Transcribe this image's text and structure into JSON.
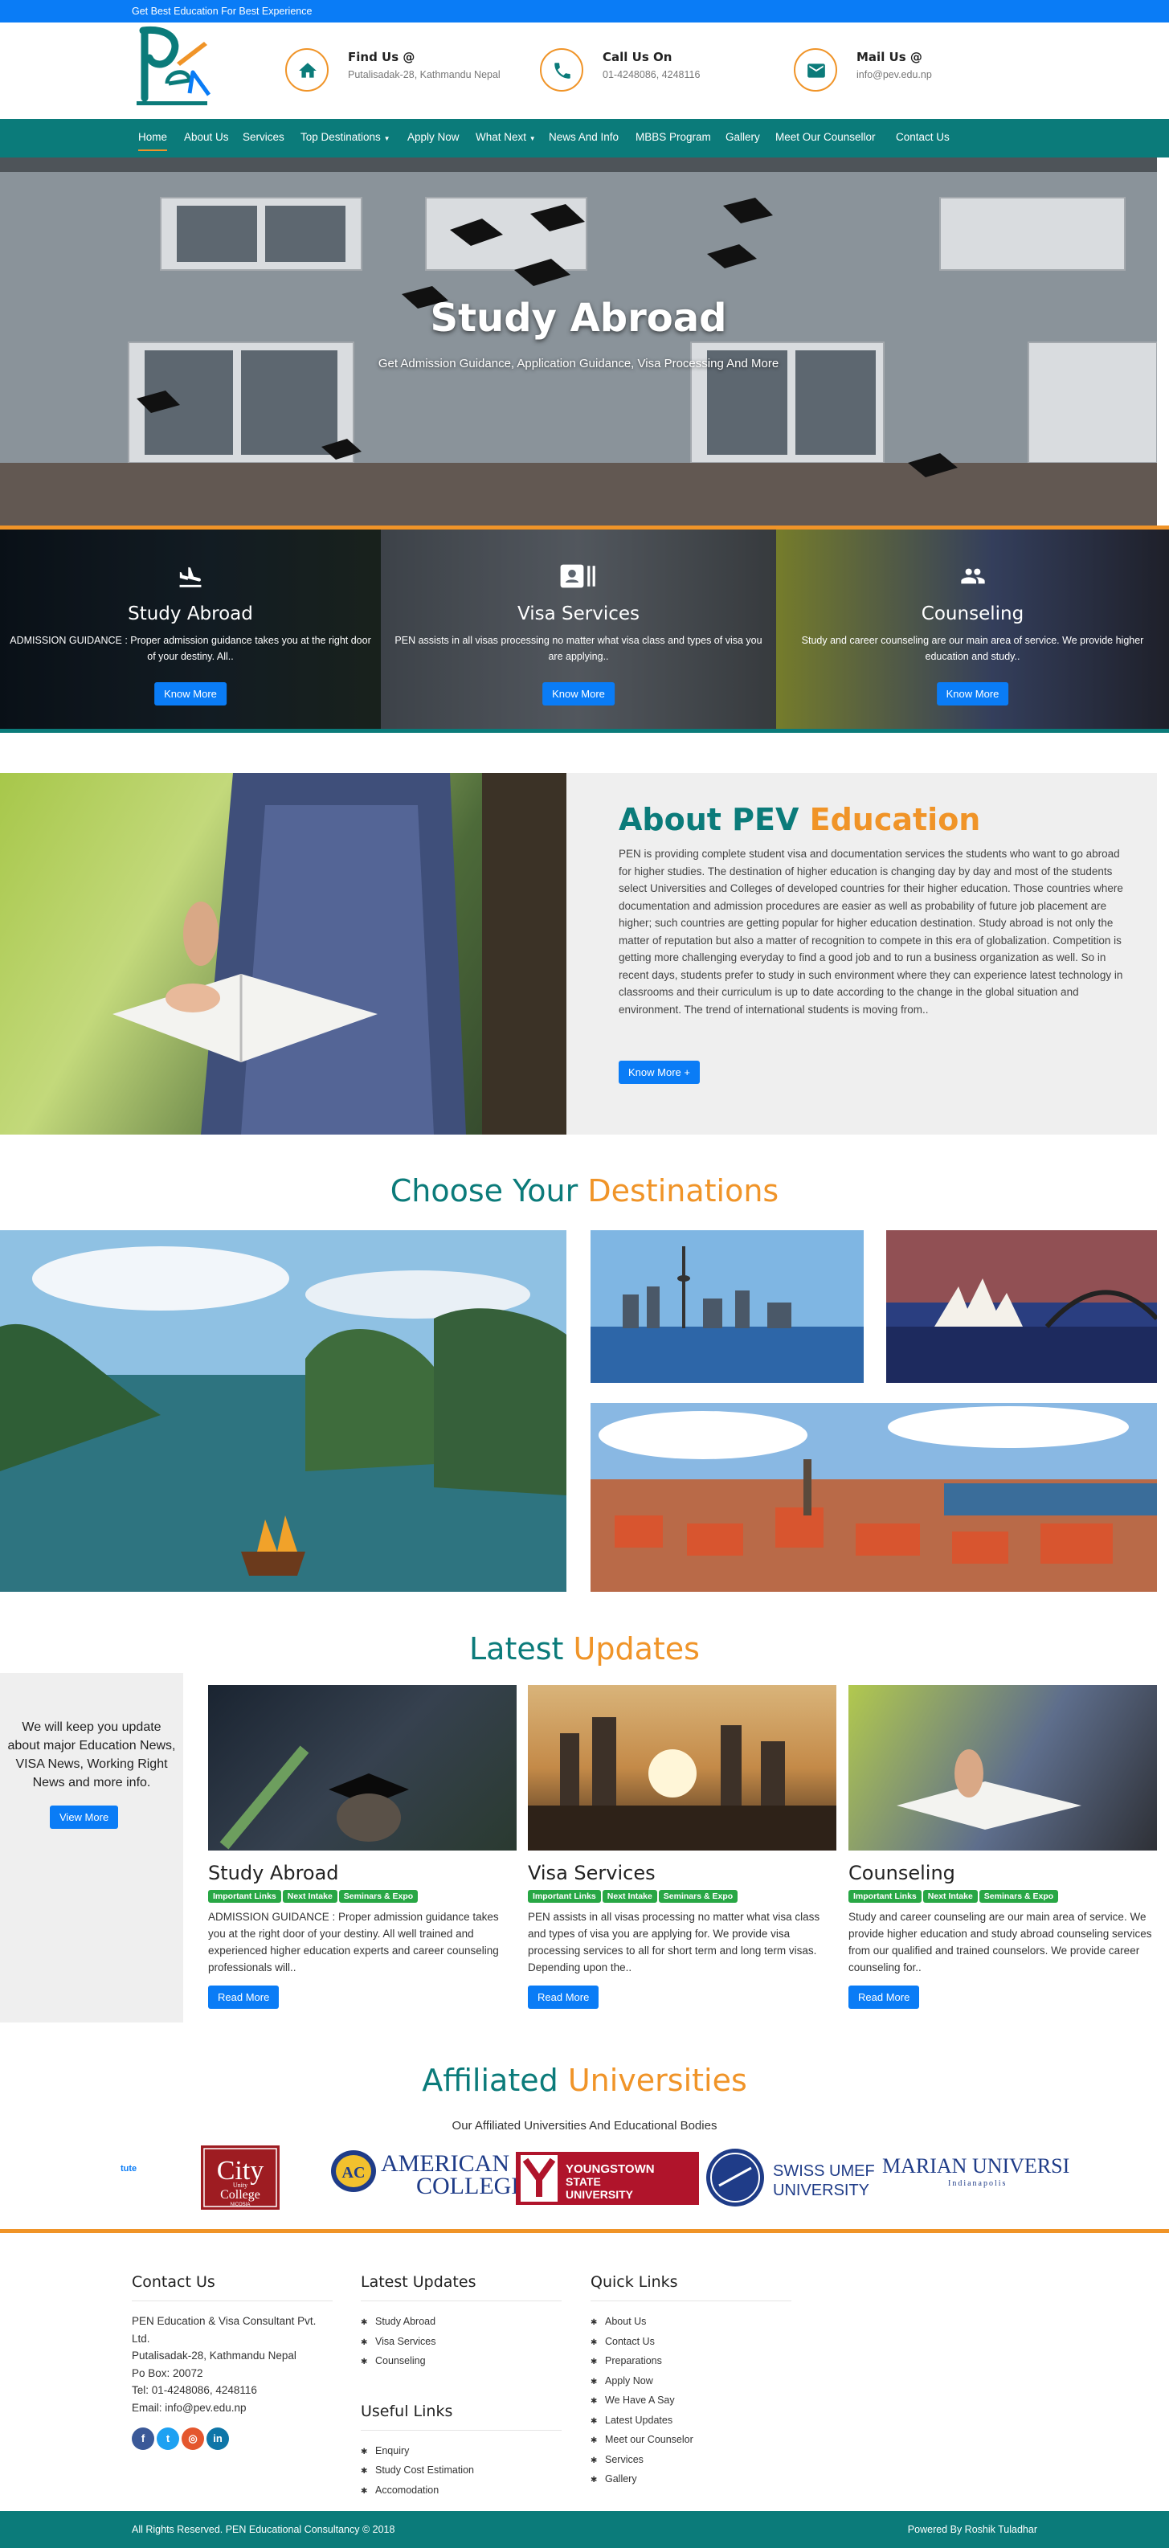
{
  "topbar": {
    "tagline": "Get Best Education For Best Experience"
  },
  "header": {
    "find": {
      "title": "Find Us @",
      "text": "Putalisadak-28, Kathmandu Nepal"
    },
    "call": {
      "title": "Call Us On",
      "text": "01-4248086, 4248116"
    },
    "mail": {
      "title": "Mail Us @",
      "text": "info@pev.edu.np"
    }
  },
  "nav": {
    "items": [
      "Home",
      "About Us",
      "Services",
      "Top Destinations",
      "Apply Now",
      "What Next",
      "News And Info",
      "MBBS Program",
      "Gallery",
      "Meet Our Counsellor",
      "Contact Us"
    ]
  },
  "hero": {
    "title": "Study Abroad",
    "subtitle": "Get Admission Guidance, Application Guidance, Visa Processing And More"
  },
  "services": [
    {
      "title": "Study Abroad",
      "text": "ADMISSION GUIDANCE : Proper admission guidance takes you at the right door of your destiny. All..",
      "button": "Know More",
      "icon": "airplane-landing-icon"
    },
    {
      "title": "Visa Services",
      "text": "PEN assists in all visas processing no matter what visa class and types of visa you are applying..",
      "button": "Know More",
      "icon": "id-card-icon"
    },
    {
      "title": "Counseling",
      "text": "Study and career counseling are our main area of service. We provide higher education and study..",
      "button": "Know More",
      "icon": "people-icon"
    }
  ],
  "about": {
    "title_a": "About PEV",
    "title_b": "Education",
    "text": "PEN is providing complete student visa and documentation services the students who want to go abroad for higher studies. The destination of higher education is changing day by day and most of the students select Universities and Colleges of developed countries for their higher education. Those countries where documentation and admission procedures are easier as well as probability of future job placement are higher; such countries are getting popular for higher education destination. Study abroad is not only the matter of reputation but also a matter of recognition to compete in this era of globalization. Competition is getting more challenging everyday to find a good job and to run a business organization as well. So in recent days, students prefer to study in such environment where they can experience latest technology in classrooms and their curriculum is up to date according to the change in the global situation and environment. The trend of international students is moving from..",
    "button": "Know More +"
  },
  "destinations": {
    "title_a": "Choose Your",
    "title_b": "Destinations"
  },
  "updates": {
    "title_a": "Latest",
    "title_b": "Updates",
    "side_text": "We will keep you update about major Education News, VISA News, Working Right News and more info.",
    "side_button": "View More",
    "tags": [
      "Important Links",
      "Next Intake",
      "Seminars & Expo"
    ],
    "cards": [
      {
        "title": "Study Abroad",
        "text": "ADMISSION GUIDANCE : Proper admission guidance takes you at the right door of your destiny. All well trained and experienced higher education experts and career counseling professionals will..",
        "button": "Read More"
      },
      {
        "title": "Visa Services",
        "text": "PEN assists in all visas processing no matter what visa class and types of visa you are applying for. We provide visa processing services to all for short term and long term visas. Depending upon the..",
        "button": "Read More"
      },
      {
        "title": "Counseling",
        "text": "Study and career counseling are our main area of service. We provide higher education and study abroad counseling services from our qualified and trained counselors. We provide career counseling for..",
        "button": "Read More"
      }
    ]
  },
  "affiliated": {
    "title_a": "Affiliated",
    "title_b": "Universities",
    "subtitle": "Our Affiliated Universities And Educational Bodies",
    "logos": {
      "partial": "tute",
      "city_a": "City",
      "city_b": "Unity",
      "city_c": "College",
      "city_d": "NICOSIA",
      "american": "AMERICAN",
      "college": "COLLEGE",
      "ac": "AC",
      "youngstown_a": "YOUNGSTOWN",
      "youngstown_b": "STATE",
      "youngstown_c": "UNIVERSITY",
      "swiss_a": "SWISS UMEF",
      "swiss_b": "UNIVERSITY",
      "marian_a": "MARIAN UNIVERSI",
      "marian_b": "Indianapolis"
    }
  },
  "footer": {
    "contact": {
      "title": "Contact Us",
      "company": "PEN Education & Visa Consultant Pvt. Ltd.",
      "address": "Putalisadak-28, Kathmandu Nepal",
      "pobox": "Po Box: 20072",
      "tel": "Tel: 01-4248086, 4248116",
      "email": "Email: info@pev.edu.np"
    },
    "latest": {
      "title": "Latest Updates",
      "items": [
        "Study Abroad",
        "Visa Services",
        "Counseling"
      ]
    },
    "useful": {
      "title": "Useful Links",
      "items": [
        "Enquiry",
        "Study Cost Estimation",
        "Accomodation"
      ]
    },
    "quick": {
      "title": "Quick Links",
      "items": [
        "About Us",
        "Contact Us",
        "Preparations",
        "Apply Now",
        "We Have A Say",
        "Latest Updates",
        "Meet our Counselor",
        "Services",
        "Gallery"
      ]
    }
  },
  "copyright": {
    "left": "All Rights Reserved. PEN Educational Consultancy © 2018",
    "right": "Powered By Roshik Tuladhar"
  },
  "colors": {
    "primary": "#0a7cf6",
    "teal": "#0b7b7a",
    "orange": "#f09428",
    "green": "#28a745"
  }
}
